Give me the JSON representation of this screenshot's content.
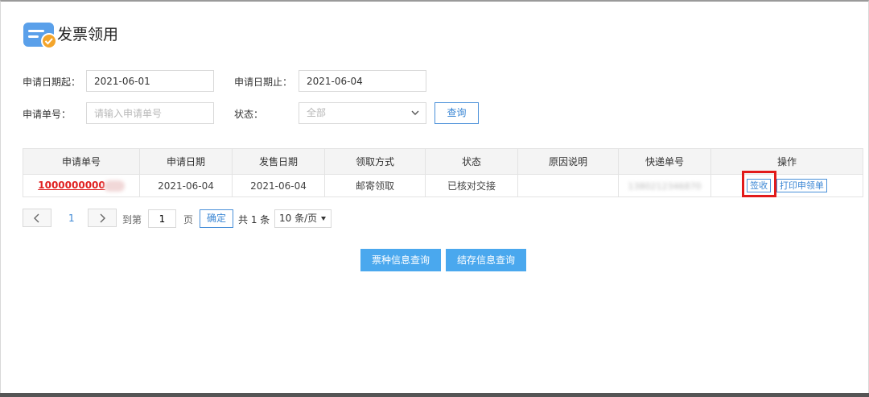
{
  "header": {
    "title": "发票领用",
    "logo_icon": "invoice-check-icon"
  },
  "filters": {
    "start_date_label": "申请日期起：",
    "start_date_value": "2021-06-01",
    "end_date_label": "申请日期止：",
    "end_date_value": "2021-06-04",
    "req_no_label": "申请单号：",
    "req_no_placeholder": "请输入申请单号",
    "status_label": "状态：",
    "status_value": "全部",
    "query_button": "查询"
  },
  "table": {
    "columns": [
      "申请单号",
      "申请日期",
      "发售日期",
      "领取方式",
      "状态",
      "原因说明",
      "快递单号",
      "操作"
    ],
    "rows": [
      {
        "req_no": "1000000000",
        "apply_date": "2021-06-04",
        "sale_date": "2021-06-04",
        "method": "邮寄领取",
        "status": "已核对交接",
        "reason": "",
        "express_no": "1380212346870",
        "actions": {
          "sign": "签收",
          "print": "打印申领单"
        }
      }
    ]
  },
  "pagination": {
    "current_page": "1",
    "goto_label": "到第",
    "goto_value": "1",
    "page_unit": "页",
    "confirm": "确定",
    "total": "共 1 条",
    "per_page": "10 条/页"
  },
  "footer_buttons": {
    "ticket_info": "票种信息查询",
    "stock_info": "结存信息查询"
  },
  "colors": {
    "accent": "#4aa8ee",
    "link_red": "#e02020",
    "highlight": "#e21b1b"
  }
}
